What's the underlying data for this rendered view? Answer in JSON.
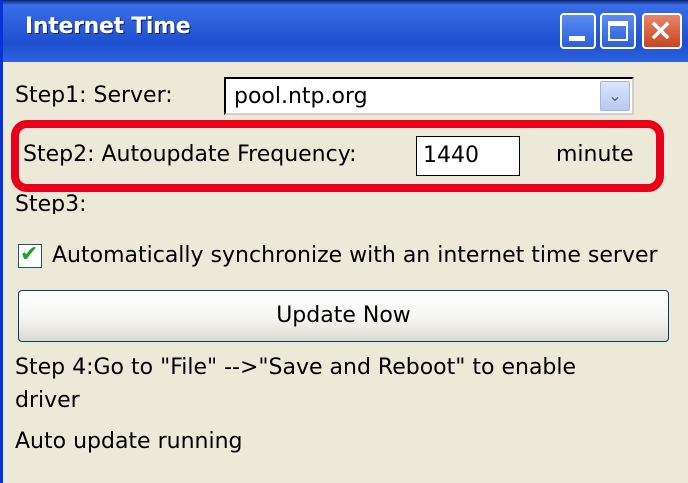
{
  "window": {
    "title": "Internet Time",
    "controls": {
      "minimize": "minimize",
      "maximize": "maximize",
      "close": "×"
    }
  },
  "step1": {
    "label": "Step1: Server:",
    "server_value": "pool.ntp.org",
    "dropdown_glyph": "⌄"
  },
  "step2": {
    "label": "Step2: Autoupdate Frequency:",
    "frequency_value": "1440",
    "unit": "minute"
  },
  "step3": {
    "label": "Step3:"
  },
  "auto_sync": {
    "checked": true,
    "label": "Automatically synchronize with an internet time server"
  },
  "update_button": {
    "label": "Update Now"
  },
  "step4": {
    "line1": "Step 4:Go to \"File\" -->\"Save and Reboot\" to enable",
    "line2": "driver"
  },
  "status": {
    "text": "Auto update running"
  },
  "colors": {
    "title_bar": "#2a5bd7",
    "highlight": "#e8001a",
    "window_bg": "#ece9d8"
  }
}
